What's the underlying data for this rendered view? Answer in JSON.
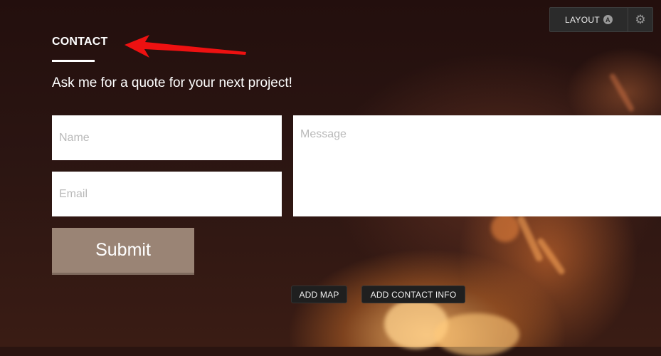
{
  "toolbar": {
    "layout_label": "LAYOUT",
    "layout_badge": "A",
    "settings_icon": "gear-icon"
  },
  "section": {
    "heading": "CONTACT",
    "tagline": "Ask me for a quote for your next project!"
  },
  "form": {
    "name_placeholder": "Name",
    "email_placeholder": "Email",
    "message_placeholder": "Message",
    "submit_label": "Submit"
  },
  "actions": {
    "add_map": "ADD MAP",
    "add_contact_info": "ADD CONTACT INFO"
  },
  "colors": {
    "submit_bg": "#9a8475",
    "annotation_arrow": "#ee1111",
    "pill_bg": "#1f1f1f"
  }
}
